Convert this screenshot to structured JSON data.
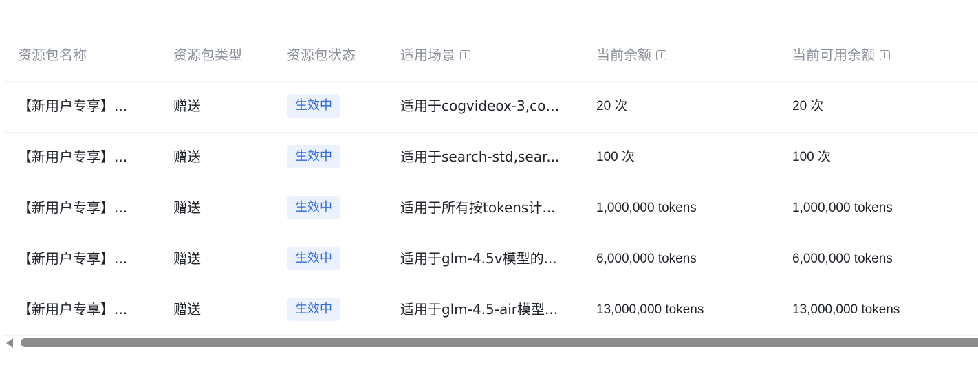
{
  "table": {
    "headers": [
      {
        "label": "资源包名称",
        "info": false
      },
      {
        "label": "资源包类型",
        "info": false
      },
      {
        "label": "资源包状态",
        "info": false
      },
      {
        "label": "适用场景",
        "info": true
      },
      {
        "label": "当前余额",
        "info": true
      },
      {
        "label": "当前可用余额",
        "info": true
      }
    ],
    "rows": [
      {
        "name": "【新用户专享】...",
        "type": "赠送",
        "status": "生效中",
        "scene": "适用于cogvideox-3,cog...",
        "balance": "20 次",
        "available": "20 次"
      },
      {
        "name": "【新用户专享】...",
        "type": "赠送",
        "status": "生效中",
        "scene": "适用于search-std,sear...",
        "balance": "100 次",
        "available": "100 次"
      },
      {
        "name": "【新用户专享】...",
        "type": "赠送",
        "status": "生效中",
        "scene": "适用于所有按tokens计...",
        "balance": "1,000,000 tokens",
        "available": "1,000,000 tokens"
      },
      {
        "name": "【新用户专享】...",
        "type": "赠送",
        "status": "生效中",
        "scene": "适用于glm-4.5v模型的...",
        "balance": "6,000,000 tokens",
        "available": "6,000,000 tokens"
      },
      {
        "name": "【新用户专享】...",
        "type": "赠送",
        "status": "生效中",
        "scene": "适用于glm-4.5-air模型...",
        "balance": "13,000,000 tokens",
        "available": "13,000,000 tokens"
      }
    ]
  },
  "colors": {
    "header_text": "#8a8f99",
    "body_text": "#1f2329",
    "status_bg": "#ebf1fd",
    "status_text": "#2f6bdb",
    "scrollbar": "#8c8c8c"
  },
  "icons": {
    "info": "info-icon",
    "scroll_left": "scroll-left-arrow-icon"
  }
}
